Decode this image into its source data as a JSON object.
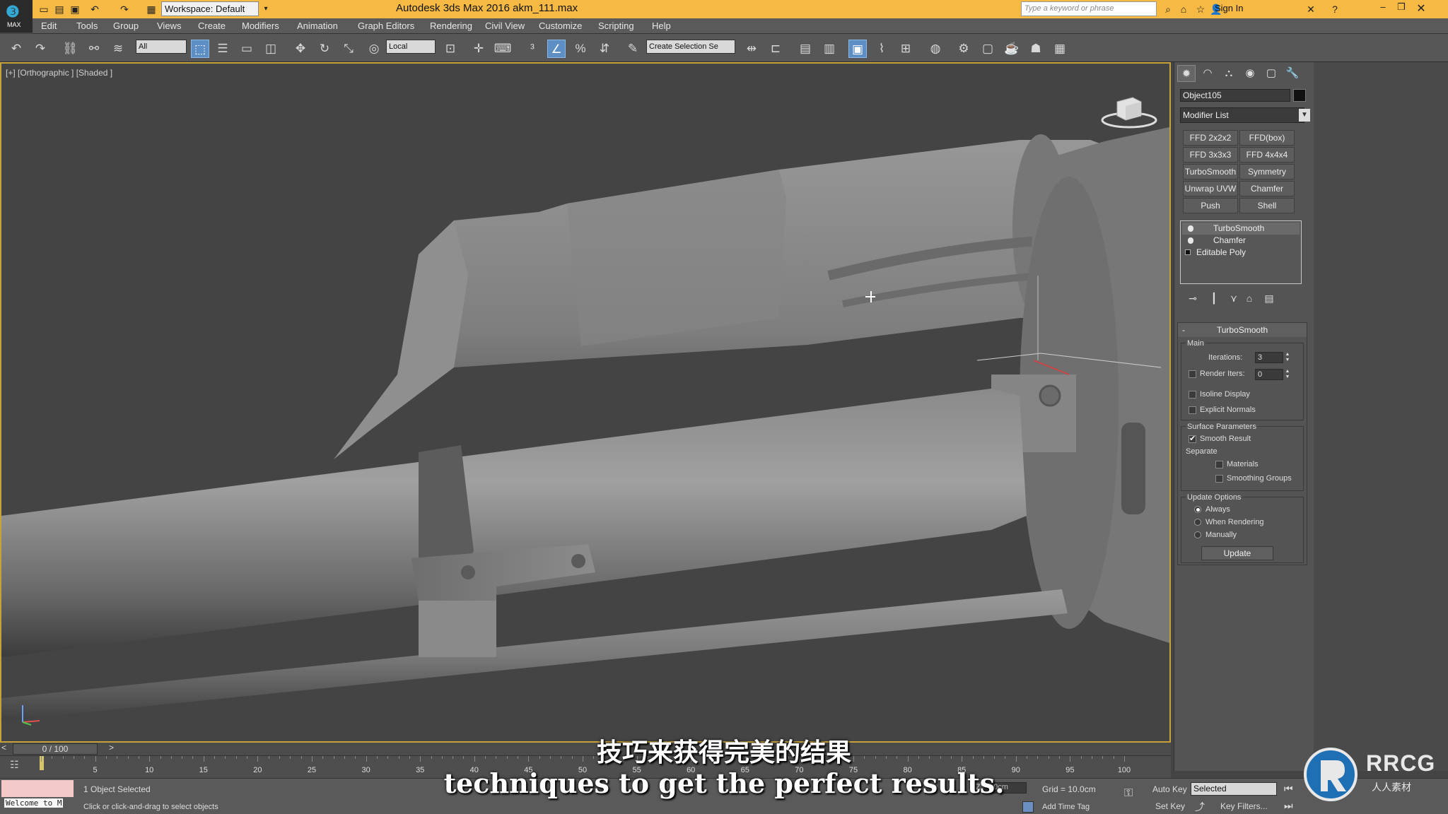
{
  "title_bar": {
    "workspace": "Workspace: Default",
    "app_title": "Autodesk 3ds Max 2016      akm_111.max",
    "search_placeholder": "Type a keyword or phrase",
    "sign_in": "Sign In"
  },
  "logo": {
    "text": "MAX"
  },
  "menu": [
    "Edit",
    "Tools",
    "Group",
    "Views",
    "Create",
    "Modifiers",
    "Animation",
    "Graph Editors",
    "Rendering",
    "Civil View",
    "Customize",
    "Scripting",
    "Help"
  ],
  "toolbar": {
    "filter_select": "All",
    "coord_select": "Local",
    "selection_set": "Create Selection Se"
  },
  "viewport": {
    "label": "[+] [Orthographic ] [Shaded ]"
  },
  "command_panel": {
    "object_name": "Object105",
    "modifier_list": "Modifier List",
    "modifier_buttons": [
      "FFD 2x2x2",
      "FFD(box)",
      "FFD 3x3x3",
      "FFD 4x4x4",
      "TurboSmooth",
      "Symmetry",
      "Unwrap UVW",
      "Chamfer",
      "Push",
      "Shell"
    ],
    "stack": [
      "TurboSmooth",
      "Chamfer",
      "Editable Poly"
    ],
    "rollout": {
      "title": "TurboSmooth",
      "main_label": "Main",
      "iterations_label": "Iterations:",
      "iterations_value": "3",
      "render_iters_label": "Render Iters:",
      "render_iters_value": "0",
      "isoline_display": "Isoline Display",
      "explicit_normals": "Explicit Normals",
      "surface_params": "Surface Parameters",
      "smooth_result": "Smooth Result",
      "separate": "Separate",
      "materials": "Materials",
      "smoothing_groups": "Smoothing Groups",
      "update_options": "Update Options",
      "always": "Always",
      "when_rendering": "When Rendering",
      "manually": "Manually",
      "update_button": "Update"
    }
  },
  "timeline": {
    "frame_counter": "0 / 100",
    "ticks": [
      "5",
      "10",
      "15",
      "20",
      "25",
      "30",
      "35",
      "40",
      "45",
      "50",
      "55",
      "60",
      "65",
      "70",
      "75",
      "80",
      "85",
      "90",
      "95",
      "100"
    ]
  },
  "status": {
    "welcome": "Welcome to M",
    "selected": "1 Object Selected",
    "prompt": "Click or click-and-drag to select objects",
    "z_label": "Z:",
    "z_value": "0.0cm",
    "grid": "Grid = 10.0cm",
    "add_time_tag": "Add Time Tag",
    "auto_key": "Auto Key",
    "set_key": "Set Key",
    "key_select": "Selected",
    "key_filters": "Key Filters..."
  },
  "subtitles": {
    "cn": "技巧来获得完美的结果",
    "en": "techniques to get the perfect results."
  },
  "watermark": {
    "text": "RRCG",
    "sub": "人人素材"
  }
}
